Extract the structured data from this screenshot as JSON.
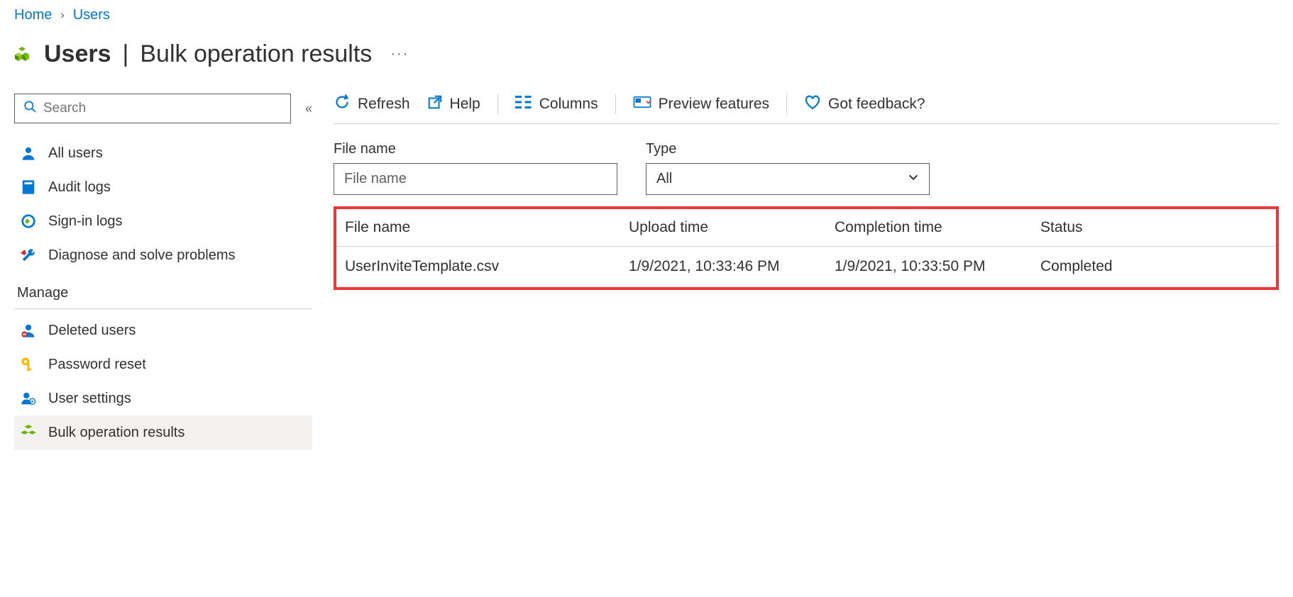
{
  "breadcrumb": {
    "home": "Home",
    "users": "Users"
  },
  "page_title": {
    "main": "Users",
    "sub": "Bulk operation results"
  },
  "sidebar": {
    "search_placeholder": "Search",
    "items": [
      {
        "label": "All users"
      },
      {
        "label": "Audit logs"
      },
      {
        "label": "Sign-in logs"
      },
      {
        "label": "Diagnose and solve problems"
      }
    ],
    "manage_header": "Manage",
    "manage_items": [
      {
        "label": "Deleted users"
      },
      {
        "label": "Password reset"
      },
      {
        "label": "User settings"
      },
      {
        "label": "Bulk operation results"
      }
    ]
  },
  "toolbar": {
    "refresh": "Refresh",
    "help": "Help",
    "columns": "Columns",
    "preview": "Preview features",
    "feedback": "Got feedback?"
  },
  "filters": {
    "filename_label": "File name",
    "filename_placeholder": "File name",
    "type_label": "Type",
    "type_value": "All"
  },
  "table": {
    "headers": {
      "file": "File name",
      "upload": "Upload time",
      "completion": "Completion time",
      "status": "Status"
    },
    "rows": [
      {
        "file": "UserInviteTemplate.csv",
        "upload": "1/9/2021, 10:33:46 PM",
        "completion": "1/9/2021, 10:33:50 PM",
        "status": "Completed"
      }
    ]
  }
}
